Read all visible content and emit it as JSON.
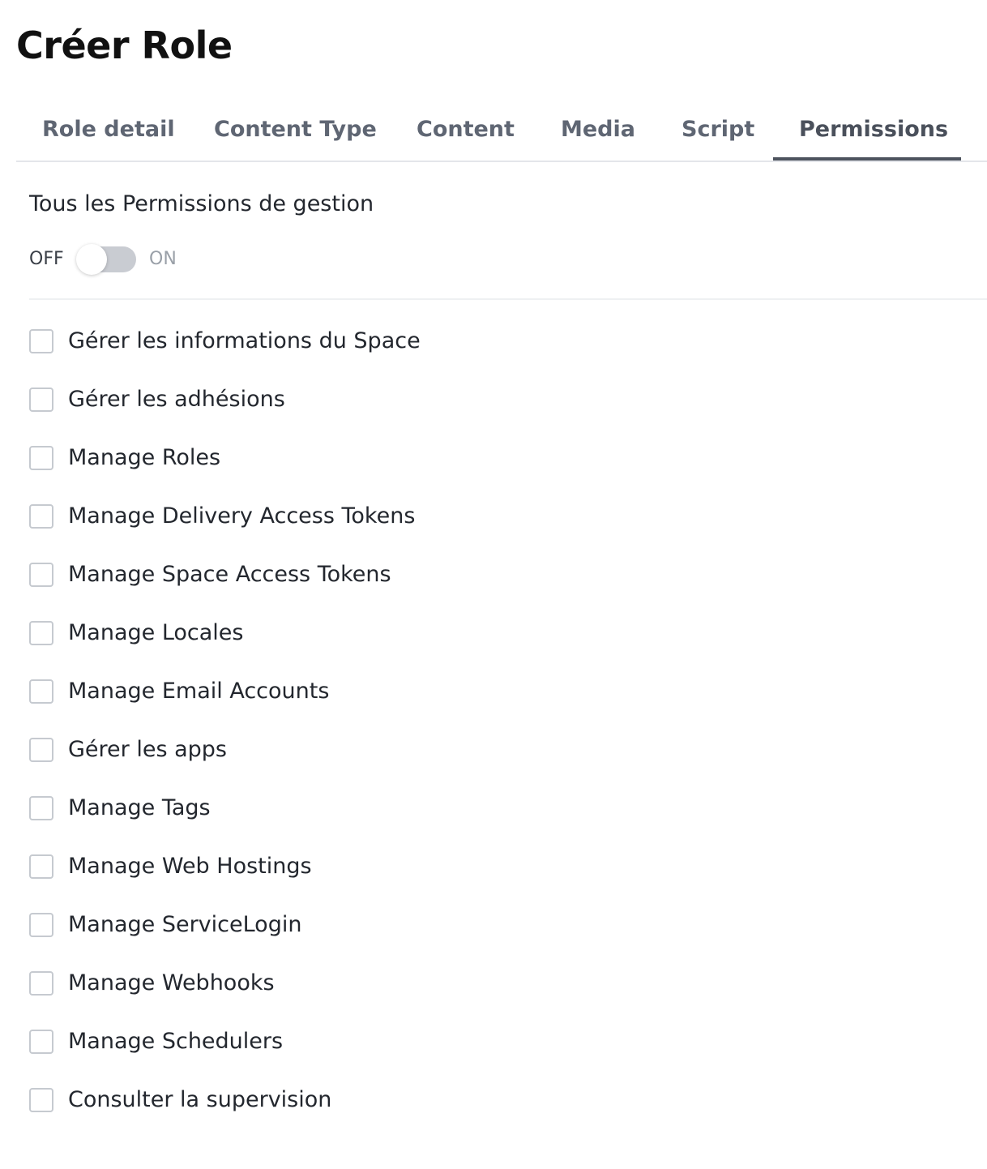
{
  "page": {
    "title": "Créer Role"
  },
  "tabs": [
    {
      "label": "Role detail",
      "active": false
    },
    {
      "label": "Content Type",
      "active": false
    },
    {
      "label": "Content",
      "active": false
    },
    {
      "label": "Media",
      "active": false
    },
    {
      "label": "Script",
      "active": false
    },
    {
      "label": "Permissions",
      "active": true
    }
  ],
  "permissions_panel": {
    "section_label": "Tous les Permissions de gestion",
    "toggle": {
      "off_label": "OFF",
      "on_label": "ON",
      "state": "off"
    },
    "items": [
      {
        "label": "Gérer les informations du Space",
        "checked": false
      },
      {
        "label": "Gérer les adhésions",
        "checked": false
      },
      {
        "label": "Manage Roles",
        "checked": false
      },
      {
        "label": "Manage Delivery Access Tokens",
        "checked": false
      },
      {
        "label": "Manage Space Access Tokens",
        "checked": false
      },
      {
        "label": "Manage Locales",
        "checked": false
      },
      {
        "label": "Manage Email Accounts",
        "checked": false
      },
      {
        "label": "Gérer les apps",
        "checked": false
      },
      {
        "label": "Manage Tags",
        "checked": false
      },
      {
        "label": "Manage Web Hostings",
        "checked": false
      },
      {
        "label": "Manage ServiceLogin",
        "checked": false
      },
      {
        "label": "Manage Webhooks",
        "checked": false
      },
      {
        "label": "Manage Schedulers",
        "checked": false
      },
      {
        "label": "Consulter la supervision",
        "checked": false
      }
    ]
  },
  "colors": {
    "active_tab_underline": "#4d535e",
    "tab_text": "#5f6673",
    "toggle_track_off": "#c9ccd2",
    "checkbox_border": "#c6cad0"
  }
}
